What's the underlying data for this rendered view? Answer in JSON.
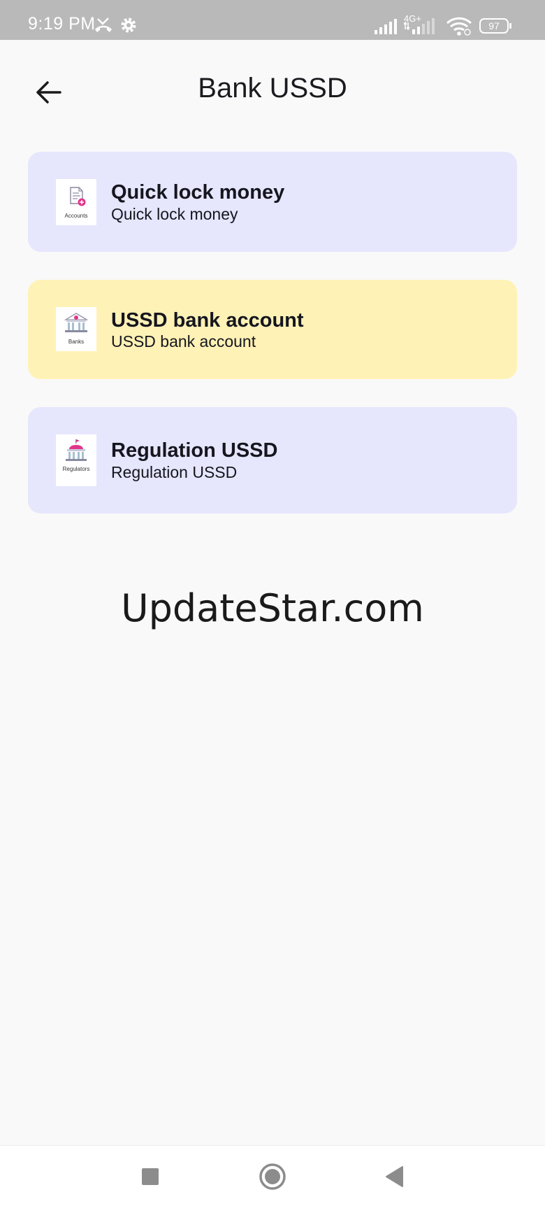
{
  "status_bar": {
    "time": "9:19 PM",
    "network_label": "4G+",
    "battery": "97",
    "icons": [
      "missed-call-icon",
      "settings-icon",
      "signal-icon",
      "signal-4g-icon",
      "wifi-icon",
      "battery-icon"
    ]
  },
  "header": {
    "title": "Bank USSD",
    "back_icon": "arrow-left-icon"
  },
  "cards": [
    {
      "title": "Quick lock money",
      "subtitle": "Quick lock money",
      "icon_caption": "Accounts",
      "icon": "accounts-document-icon",
      "background": "#e6e6fd"
    },
    {
      "title": "USSD bank account",
      "subtitle": "USSD bank account",
      "icon_caption": "Banks",
      "icon": "bank-building-icon",
      "background": "#fff2b6"
    },
    {
      "title": "Regulation USSD",
      "subtitle": "Regulation USSD",
      "icon_caption": "Regulators",
      "icon": "regulator-building-icon",
      "background": "#e6e6fd"
    }
  ],
  "watermark": "UpdateStar.com",
  "nav_bar": {
    "icons": [
      "recents-square-icon",
      "home-circle-icon",
      "back-triangle-icon"
    ]
  },
  "colors": {
    "accent_pink": "#e0358c",
    "card_lavender": "#e6e6fd",
    "card_yellow": "#fff2b6",
    "status_bar": "#b9b9b9"
  }
}
